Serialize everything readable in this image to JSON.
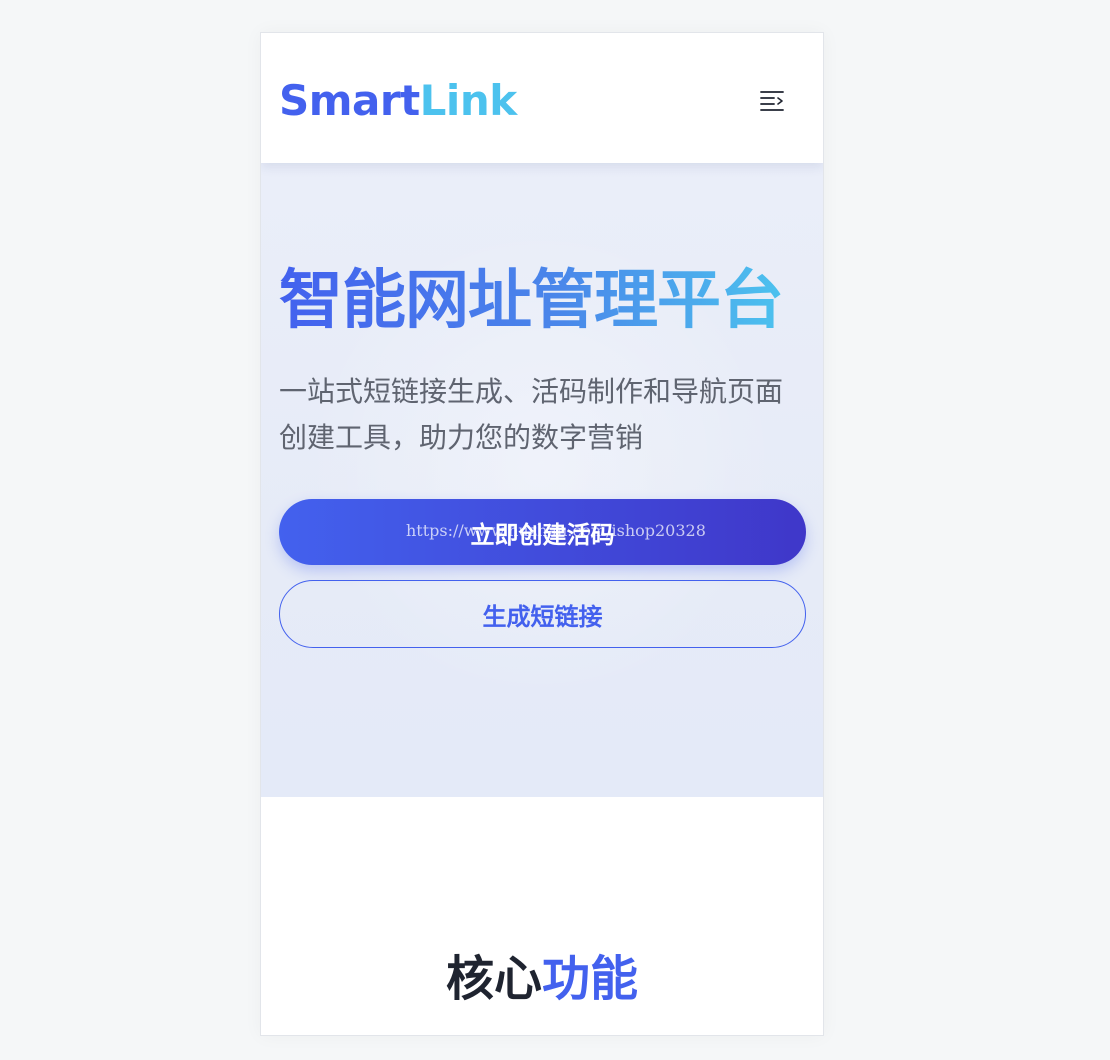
{
  "header": {
    "logo_part1": "Smart",
    "logo_part2": "Link",
    "menu_icon": "menu-icon"
  },
  "hero": {
    "title": "智能网址管理平台",
    "subtitle": "一站式短链接生成、活码制作和导航页面创建工具，助力您的数字营销",
    "primary_button_label": "立即创建活码",
    "secondary_button_label": "生成短链接",
    "watermark": "https://www.huzhan.com/ishop20328"
  },
  "features": {
    "title_part1": "核心",
    "title_part2": "功能"
  },
  "colors": {
    "brand_primary": "#4361ee",
    "brand_secondary": "#4cc2ee",
    "button_gradient_end": "#3f37c9",
    "text_dark": "#1f2430",
    "text_muted": "#5f6470",
    "page_background": "#f5f7f8",
    "hero_background": "#e6ebf7"
  }
}
